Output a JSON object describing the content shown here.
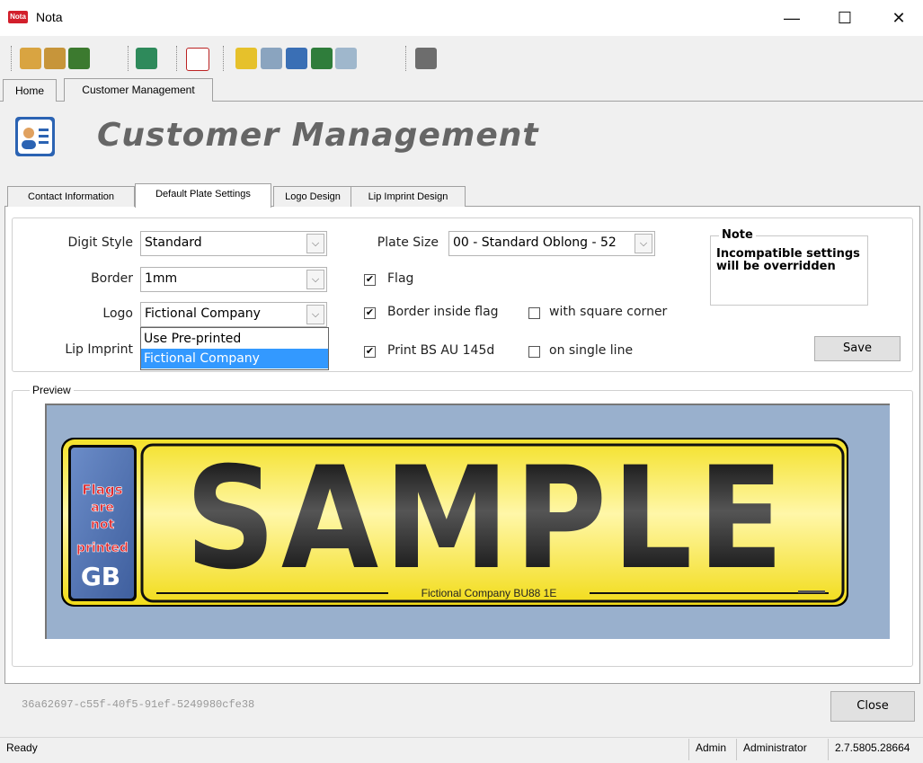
{
  "window": {
    "title": "Nota",
    "logo_text": "Nota",
    "minimize": "—",
    "maximize": "☐",
    "close": "✕"
  },
  "toolbar": {
    "icons": [
      "add-customer-icon",
      "customer-icon",
      "exit-icon",
      "cs-icon",
      "text-icon",
      "s-icon",
      "grid-icon",
      "contact-card-icon",
      "sql-icon",
      "print-settings-icon",
      "vault-icon"
    ]
  },
  "outer_tabs": [
    {
      "label": "Home"
    },
    {
      "label": "Customer Management"
    }
  ],
  "page": {
    "title": "Customer Management"
  },
  "inner_tabs": [
    {
      "label": "Contact Information"
    },
    {
      "label": "Default Plate Settings"
    },
    {
      "label": "Logo Design"
    },
    {
      "label": "Lip Imprint Design"
    }
  ],
  "settings": {
    "digit_style_label": "Digit Style",
    "digit_style_value": "Standard",
    "border_label": "Border",
    "border_value": "1mm",
    "logo_label": "Logo",
    "logo_value": "Fictional Company",
    "lip_imprint_label": "Lip Imprint",
    "lip_options": [
      "Use Pre-printed",
      "Fictional Company"
    ],
    "plate_size_label": "Plate Size",
    "plate_size_value": "00 - Standard Oblong - 52",
    "flag_label": "Flag",
    "border_inside_flag_label": "Border inside flag",
    "square_corner_label": "with square corner",
    "print_bs_label": "Print BS AU 145d",
    "single_line_label": "on single line",
    "save_label": "Save",
    "check_mark": "✔"
  },
  "note": {
    "title": "Note",
    "text": "Incompatible settings will be overridden"
  },
  "preview": {
    "label": "Preview",
    "plate_text": "SAMPLE",
    "flag_text": [
      "Flags",
      "are",
      "not",
      "printed"
    ],
    "flag_country": "GB",
    "dealer_line": "Fictional Company   BU88 1E"
  },
  "footer": {
    "guid": "36a62697-c55f-40f5-91ef-5249980cfe38",
    "close_label": "Close"
  },
  "status": {
    "ready": "Ready",
    "user": "Admin",
    "role": "Administrator",
    "version": "2.7.5805.28664"
  }
}
